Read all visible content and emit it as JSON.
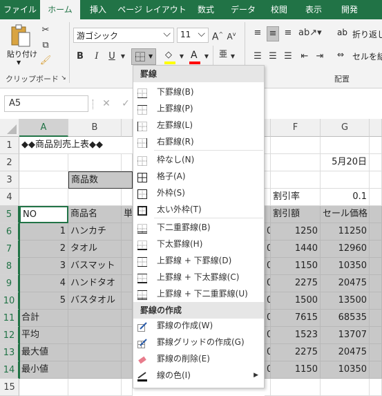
{
  "tabs": [
    "ファイル",
    "ホーム",
    "挿入",
    "ページ レイアウト",
    "数式",
    "データ",
    "校閲",
    "表示",
    "開発"
  ],
  "ribbon": {
    "paste_label": "貼り付け",
    "clipboard_group": "クリップボード",
    "font_name": "游ゴシック",
    "font_size": "11",
    "bold": "B",
    "italic": "I",
    "underline": "U",
    "font_grow": "A",
    "font_shrink": "A",
    "font_color_glyph": "A",
    "wrap_label": "折り返し",
    "merge_label": "セルを結",
    "align_group": "配置",
    "fill_color": "#ffff00",
    "font_color": "#ff0000"
  },
  "formula_bar": {
    "name_box": "A5"
  },
  "columns": [
    "A",
    "B",
    "F",
    "G"
  ],
  "rows": [
    "1",
    "2",
    "3",
    "4",
    "5",
    "6",
    "7",
    "8",
    "9",
    "10",
    "11",
    "12",
    "13",
    "14",
    "15"
  ],
  "cells": {
    "title": "◆◆商品別売上表◆◆",
    "date": "5月20日",
    "count_label": "商品数",
    "discount_rate_label": "割引率",
    "discount_rate": "0.1",
    "h_no": "NO",
    "h_name": "商品名",
    "h_unit": "単",
    "h_discount": "割引額",
    "h_sale": "セール価格",
    "data": [
      {
        "no": "1",
        "name": "ハンカチ",
        "c": "0",
        "disc": "1250",
        "sale": "11250"
      },
      {
        "no": "2",
        "name": "タオル",
        "c": "0",
        "disc": "1440",
        "sale": "12960"
      },
      {
        "no": "3",
        "name": "バスマット",
        "c": "0",
        "disc": "1150",
        "sale": "10350"
      },
      {
        "no": "4",
        "name": "ハンドタオ",
        "c": "0",
        "disc": "2275",
        "sale": "20475"
      },
      {
        "no": "5",
        "name": "バスタオル",
        "c": "0",
        "disc": "1500",
        "sale": "13500"
      }
    ],
    "summary": [
      {
        "label": "合計",
        "c": "0",
        "disc": "7615",
        "sale": "68535"
      },
      {
        "label": "平均",
        "c": "0",
        "disc": "1523",
        "sale": "13707"
      },
      {
        "label": "最大値",
        "c": "0",
        "disc": "2275",
        "sale": "20475"
      },
      {
        "label": "最小値",
        "c": "0",
        "disc": "1150",
        "sale": "10350"
      }
    ]
  },
  "menu": {
    "header1": "罫線",
    "items1": [
      "下罫線(B)",
      "上罫線(P)",
      "左罫線(L)",
      "右罫線(R)"
    ],
    "items2": [
      "枠なし(N)",
      "格子(A)",
      "外枠(S)",
      "太い外枠(T)"
    ],
    "items3": [
      "下二重罫線(B)",
      "下太罫線(H)",
      "上罫線 + 下罫線(D)",
      "上罫線 + 下太罫線(C)",
      "上罫線 + 下二重罫線(U)"
    ],
    "header2": "罫線の作成",
    "items4": [
      "罫線の作成(W)",
      "罫線グリッドの作成(G)",
      "罫線の削除(E)",
      "線の色(I)"
    ]
  }
}
